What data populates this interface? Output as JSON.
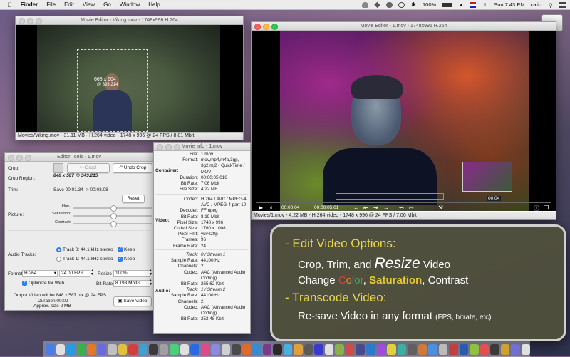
{
  "menubar": {
    "apple": "",
    "items": [
      "Finder",
      "File",
      "Edit",
      "View",
      "Go",
      "Window",
      "Help"
    ],
    "battery": "100%",
    "clock": "Sun 7:43 PM",
    "user": "calin"
  },
  "viking": {
    "title": "Movie Editor - Viking.mov - 1748x996 H.264",
    "crop_size": "668 x 604",
    "crop_origin": "@ 393,214",
    "status": "Movies/Viking.mov - 31.11 MB - H.264 video - 1748 x 996 @ 24 FPS / 8.81 Mbit"
  },
  "main": {
    "title": "Movie Editor - 1.mov - 1748x996 H.264",
    "time_current": "00:00:04",
    "time_total": "00:00:05.01",
    "thumb_time": "00:04",
    "status": "Movies/1.mov - 4.22 MB - H.264 video - 1748 x 996 @ 24 FPS / 7.06 Mbit"
  },
  "tools": {
    "title": "Editor Tools - 1.mov",
    "crop_label": "Crop:",
    "crop_btn": "Crop!",
    "undo_btn": "Undo Crop",
    "crop_region_label": "Crop Region:",
    "crop_region": "848 x 587 @ 349,215",
    "trim_label": "Trim:",
    "trim_value": "Save 00:01.34 -> 00:03.08",
    "reset_btn": "Reset",
    "picture_label": "Picture:",
    "hue": "Hue:",
    "saturation": "Saturation:",
    "contrast": "Contrast:",
    "audio_label": "Audio Tracks:",
    "track0": "Track 0: 44.1 kHz stereo",
    "track1": "Track 1: 44.1 kHz stereo",
    "keep": "Keep",
    "format_label": "Format:",
    "format_value": "H.264",
    "fps_value": "24.00 FPS",
    "resize_label": "Resize",
    "resize_value": "100%",
    "optimize": "Optimize for Web",
    "bitrate_label": "Bit Rate",
    "bitrate_value": "8.193 Mbit/s",
    "output_line1": "Output Video will be 848 x 587 pix @ 24 FPS",
    "output_line2": "Duration 00:02",
    "output_line3": "Approx. size 2 MB",
    "save_btn": "Save Video"
  },
  "info": {
    "title": "Movie Info - 1.mov",
    "container_label": "Container:",
    "video_label": "Video:",
    "audio_label": "Audio:",
    "container": [
      {
        "k": "File:",
        "v": "1.mov"
      },
      {
        "k": "Format:",
        "v": "mov,mp4,m4a,3gp,"
      },
      {
        "k": "",
        "v": "3g2,mj2 - QuickTime /"
      },
      {
        "k": "",
        "v": "MOV"
      },
      {
        "k": "Duration:",
        "v": "00:00:05.016"
      },
      {
        "k": "Bit Rate:",
        "v": "7.06 Mbit"
      },
      {
        "k": "File Size:",
        "v": "4.22 MB"
      }
    ],
    "video": [
      {
        "k": "Codec:",
        "v": "H.264 / AVC / MPEG-4"
      },
      {
        "k": "",
        "v": "AVC / MPEG-4 part 10"
      },
      {
        "k": "Decoder:",
        "v": "FFmpeg"
      },
      {
        "k": "Bit Rate:",
        "v": "8.19 Mbit"
      },
      {
        "k": "Pixel Size:",
        "v": "1748 x 996"
      },
      {
        "k": "Coded Size:",
        "v": "1760 x 1008"
      },
      {
        "k": "Pixel Fmt:",
        "v": "yuv420p"
      },
      {
        "k": "Frames:",
        "v": "96"
      },
      {
        "k": "Frame Rate:",
        "v": "24"
      }
    ],
    "audio": [
      {
        "k": "Track:",
        "v": "0 / Stream 1"
      },
      {
        "k": "Sample Rate:",
        "v": "44100 Hz"
      },
      {
        "k": "Channels:",
        "v": "2"
      },
      {
        "k": "Codec:",
        "v": "AAC (Advanced Audio"
      },
      {
        "k": "",
        "v": "Coding)"
      },
      {
        "k": "Bit Rate:",
        "v": "265.62 Kbit"
      },
      {
        "k": "Track:",
        "v": "1 / Stream 2"
      },
      {
        "k": "Sample Rate:",
        "v": "44100 Hz"
      },
      {
        "k": "Channels:",
        "v": "2"
      },
      {
        "k": "Codec:",
        "v": "AAC (Advanced Audio"
      },
      {
        "k": "",
        "v": "Coding)"
      },
      {
        "k": "Bit Rate:",
        "v": "252.48 Kbit"
      }
    ]
  },
  "promo": {
    "line1": "- Edit Video Options:",
    "line2a": "Crop, Trim, and ",
    "line2b": "Resize",
    "line2c": " Video",
    "line3a": "Change ",
    "line3_color": [
      "C",
      "o",
      "l",
      "o",
      "r"
    ],
    "line3b": ", ",
    "line3c": "Saturation",
    "line3d": ", Contrast",
    "line4": "- Transcode Video:",
    "line5a": "Re-save Video in any format ",
    "line5b": "(FPS, bitrate, etc)"
  },
  "colors": {
    "accent": "#2f7df6",
    "promo_yellow": "#e8d84a"
  }
}
